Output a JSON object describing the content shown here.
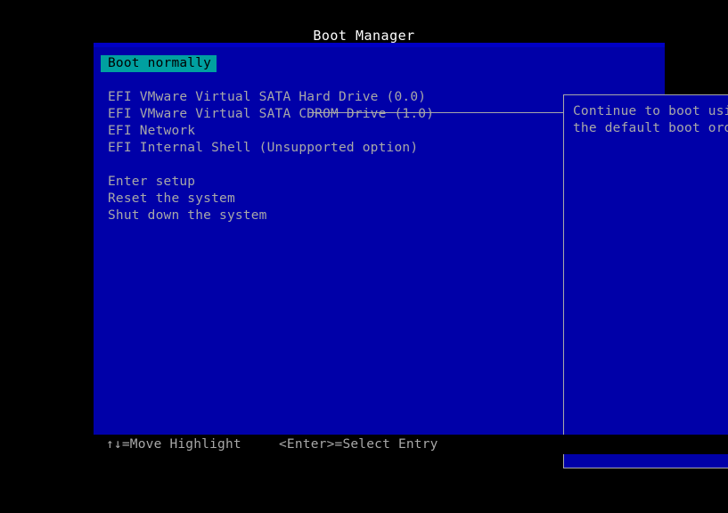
{
  "title": "Boot Manager",
  "menu": {
    "items": [
      {
        "label": "Boot normally",
        "selected": true,
        "spacer_after": true
      },
      {
        "label": "EFI VMware Virtual SATA Hard Drive (0.0)",
        "selected": false,
        "spacer_after": false
      },
      {
        "label": "EFI VMware Virtual SATA CDROM Drive (1.0)",
        "selected": false,
        "spacer_after": false
      },
      {
        "label": "EFI Network",
        "selected": false,
        "spacer_after": false
      },
      {
        "label": "EFI Internal Shell (Unsupported option)",
        "selected": false,
        "spacer_after": true
      },
      {
        "label": "Enter setup",
        "selected": false,
        "spacer_after": false
      },
      {
        "label": "Reset the system",
        "selected": false,
        "spacer_after": false
      },
      {
        "label": "Shut down the system",
        "selected": false,
        "spacer_after": false
      }
    ]
  },
  "help": {
    "text": "Continue to boot using\nthe default boot order."
  },
  "footer": {
    "move_hint": "↑↓=Move Highlight",
    "select_hint": "<Enter>=Select Entry"
  },
  "colors": {
    "screen_background": "#000000",
    "panel_background": "#0000a8",
    "panel_top_strip": "#0000c4",
    "text": "#a8a8a8",
    "title_text": "#ffffff",
    "highlight_background": "#00a0a0",
    "highlight_text": "#000000",
    "border": "#a8a8a8"
  }
}
